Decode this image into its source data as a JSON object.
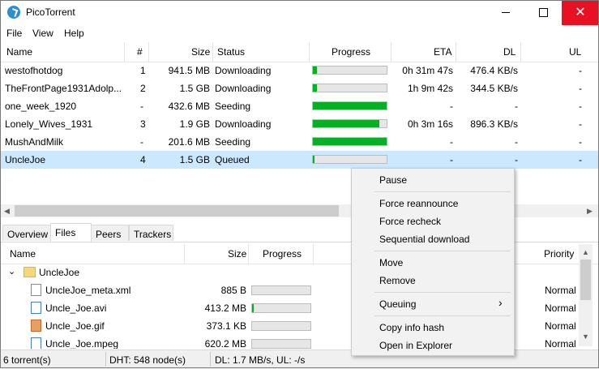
{
  "window": {
    "title": "PicoTorrent",
    "close_glyph": "✕"
  },
  "menu": [
    "File",
    "View",
    "Help"
  ],
  "torrent_columns": {
    "name": "Name",
    "num": "#",
    "size": "Size",
    "status": "Status",
    "progress": "Progress",
    "eta": "ETA",
    "dl": "DL",
    "ul": "UL"
  },
  "torrents": [
    {
      "name": "westofhotdog",
      "num": "1",
      "size": "941.5 MB",
      "status": "Downloading",
      "progress": 0.05,
      "eta": "0h 31m 47s",
      "dl": "476.4 KB/s",
      "ul": "-"
    },
    {
      "name": "TheFrontPage1931Adolp...",
      "num": "2",
      "size": "1.5 GB",
      "status": "Downloading",
      "progress": 0.05,
      "eta": "1h 9m 42s",
      "dl": "344.5 KB/s",
      "ul": "-"
    },
    {
      "name": "one_week_1920",
      "num": "-",
      "size": "432.6 MB",
      "status": "Seeding",
      "progress": 1.0,
      "eta": "-",
      "dl": "-",
      "ul": "-"
    },
    {
      "name": "Lonely_Wives_1931",
      "num": "3",
      "size": "1.9 GB",
      "status": "Downloading",
      "progress": 0.9,
      "eta": "0h 3m 16s",
      "dl": "896.3 KB/s",
      "ul": "-"
    },
    {
      "name": "MushAndMilk",
      "num": "-",
      "size": "201.6 MB",
      "status": "Seeding",
      "progress": 1.0,
      "eta": "-",
      "dl": "-",
      "ul": "-"
    },
    {
      "name": "UncleJoe",
      "num": "4",
      "size": "1.5 GB",
      "status": "Queued",
      "progress": 0.02,
      "eta": "-",
      "dl": "-",
      "ul": "-",
      "selected": true
    }
  ],
  "tabs": [
    "Overview",
    "Files",
    "Peers",
    "Trackers"
  ],
  "active_tab": "Files",
  "file_columns": {
    "name": "Name",
    "size": "Size",
    "progress": "Progress",
    "priority": "Priority"
  },
  "files": [
    {
      "name": "UncleJoe",
      "type": "folder",
      "expander": "⌄"
    },
    {
      "name": "UncleJoe_meta.xml",
      "size": "885 B",
      "progress": 0.0,
      "priority": "Normal",
      "icon": "xml-file-icon"
    },
    {
      "name": "Uncle_Joe.avi",
      "size": "413.2 MB",
      "progress": 0.03,
      "priority": "Normal",
      "icon": "video-file-icon"
    },
    {
      "name": "Uncle_Joe.gif",
      "size": "373.1 KB",
      "progress": 0.0,
      "priority": "Normal",
      "icon": "image-file-icon"
    },
    {
      "name": "Uncle_Joe.mpeg",
      "size": "620.2 MB",
      "progress": 0.0,
      "priority": "Normal",
      "icon": "video-file-icon"
    }
  ],
  "context_menu": {
    "items": [
      "Pause",
      "Force reannounce",
      "Force recheck",
      "Sequential download",
      "Move",
      "Remove",
      "Queuing",
      "Copy info hash",
      "Open in Explorer"
    ],
    "submenu_arrow": "›"
  },
  "status": {
    "torrents": "6 torrent(s)",
    "dht": "DHT: 548 node(s)",
    "rates": "DL: 1.7 MB/s, UL: -/s"
  },
  "colors": {
    "progress": "#06b025",
    "selection": "#cce8ff",
    "close": "#e81123"
  }
}
